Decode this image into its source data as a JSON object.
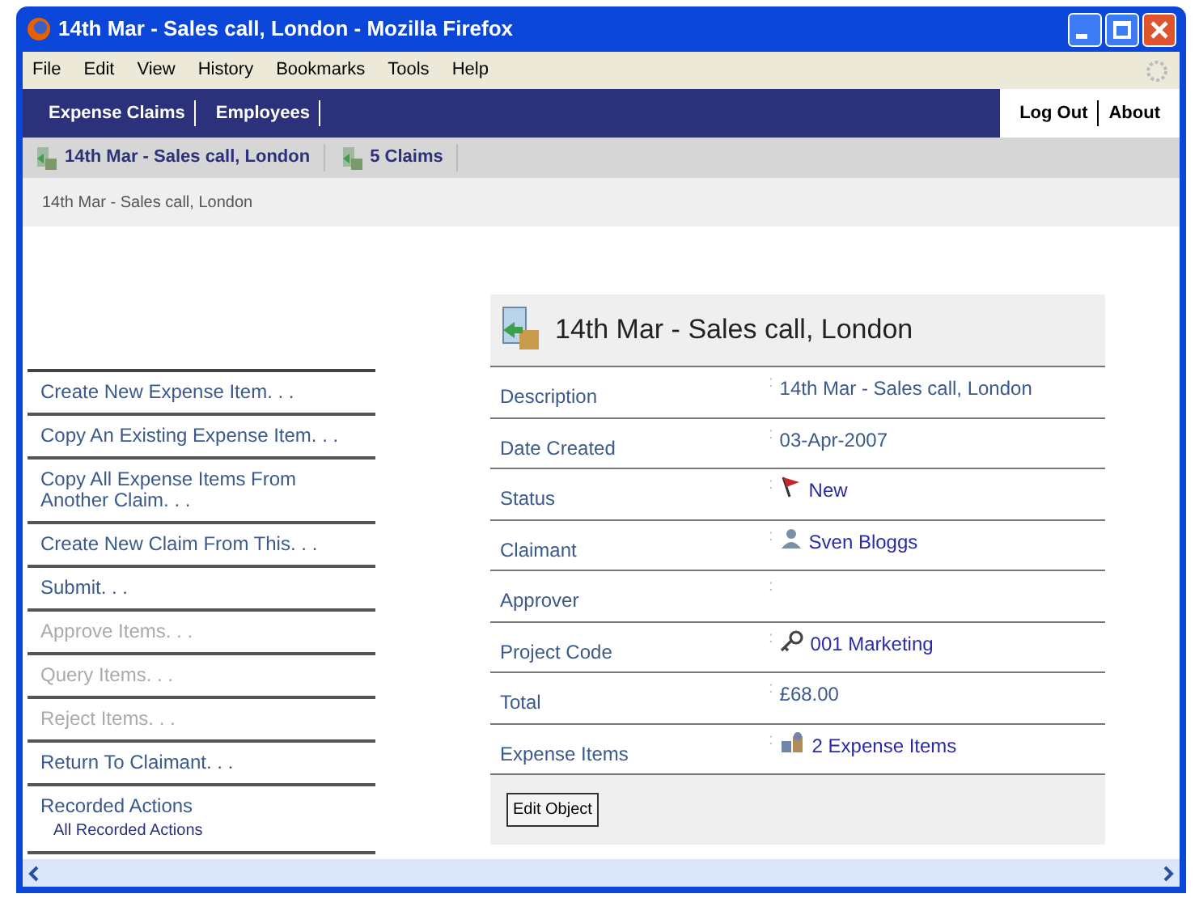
{
  "window": {
    "title": "14th Mar - Sales call, London - Mozilla Firefox"
  },
  "menu_bar": [
    {
      "label": "File"
    },
    {
      "label": "Edit"
    },
    {
      "label": "View"
    },
    {
      "label": "History"
    },
    {
      "label": "Bookmarks"
    },
    {
      "label": "Tools"
    },
    {
      "label": "Help"
    }
  ],
  "nav_bar": {
    "left": [
      "Expense Claims",
      "Employees"
    ],
    "right": [
      "Log Out",
      "About"
    ]
  },
  "breadcrumbs": [
    "14th Mar - Sales call, London",
    "5 Claims"
  ],
  "path": "14th Mar - Sales call, London",
  "actions": [
    {
      "label": "Create New Expense Item. . .",
      "disabled": false
    },
    {
      "label": "Copy An Existing Expense Item. . .",
      "disabled": false
    },
    {
      "label": "Copy All Expense Items From Another Claim. . .",
      "disabled": false
    },
    {
      "label": "Create New Claim From This. . .",
      "disabled": false
    },
    {
      "label": "Submit. . .",
      "disabled": false
    },
    {
      "label": "Approve Items. . .",
      "disabled": true
    },
    {
      "label": "Query Items. . .",
      "disabled": true
    },
    {
      "label": "Reject Items. . .",
      "disabled": true
    },
    {
      "label": "Return To Claimant. . .",
      "disabled": false
    },
    {
      "label": "Recorded Actions",
      "disabled": false,
      "sub": "All Recorded Actions"
    }
  ],
  "detail": {
    "title": "14th Mar - Sales call, London",
    "fields": [
      {
        "label": "Description",
        "separator": ":",
        "kind": "text",
        "value": "14th Mar - Sales call, London"
      },
      {
        "label": "Date Created",
        "separator": ":",
        "kind": "text",
        "value": "03-Apr-2007"
      },
      {
        "label": "Status",
        "separator": ":",
        "kind": "flag",
        "value": "New"
      },
      {
        "label": "Claimant",
        "separator": ":",
        "kind": "person",
        "value": "Sven Bloggs"
      },
      {
        "label": "Approver",
        "separator": ":"
      },
      {
        "label": "Project Code",
        "separator": ":",
        "kind": "key",
        "value": "001 Marketing"
      },
      {
        "label": "Total",
        "separator": ":",
        "kind": "text",
        "value": "£68.00"
      },
      {
        "label": "Expense Items",
        "separator": ":",
        "kind": "items",
        "value": "2 Expense Items"
      }
    ],
    "button": "Edit Object"
  }
}
